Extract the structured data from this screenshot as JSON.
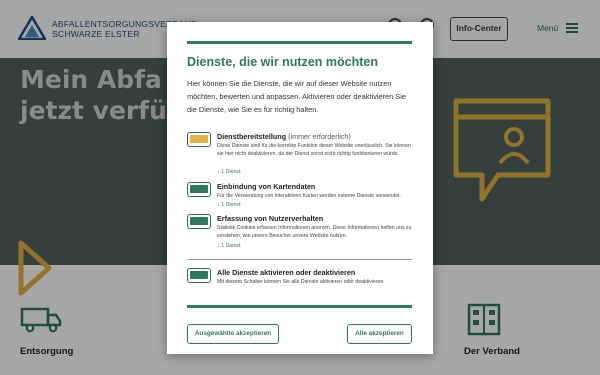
{
  "header": {
    "brand_line1": "ABFALLENTSORGUNGSVERBAND",
    "brand_line2": "SCHWARZE ELSTER",
    "info_button": "Info-Center",
    "menu_label": "Menü"
  },
  "hero": {
    "title_line1": "Mein Abfa",
    "title_line2": "jetzt verfüg"
  },
  "tiles": [
    {
      "label": "Entsorgung"
    },
    {
      "label": "Der Verband"
    }
  ],
  "modal": {
    "title": "Dienste, die wir nutzen möchten",
    "intro": "Hier können Sie die Dienste, die wir auf dieser Website nutzen möchten, bewerten und anpassen. Aktivieren oder deaktivieren Sie die Dienste, wie Sie es für richtig halten.",
    "services": [
      {
        "name": "Dienstbereitstellung",
        "note": "(immer erforderlich)",
        "description": "Diese Dienste sind für die korrekte Funktion dieser Website unerlässlich. Sie können sie hier nicht deaktivieren, da der Dienst sonst nicht richtig funktionieren würde.",
        "count": "↓ 1 Dienst"
      },
      {
        "name": "Einbindung von Kartendaten",
        "description": "Für die Verwendung von interaktiven Karten werden externe Dienste verwendet.",
        "count": "↓ 1 Dienst"
      },
      {
        "name": "Erfassung von Nutzerverhalten",
        "description": "Statistik Cookies erfassen Informationen anonym. Diese Informationen helfen uns zu verstehen, wie unsere Besucher unsere Website nutzen.",
        "count": "↓ 1 Dienst"
      }
    ],
    "all_toggle": {
      "name": "Alle Dienste aktivieren oder deaktivieren",
      "description": "Mit diesem Schalter können Sie alle Dienste aktivieren oder deaktivieren."
    },
    "accept_selected": "Ausgewählte akzeptieren",
    "accept_all": "Alle akzeptieren"
  },
  "colors": {
    "accent_green": "#2e7a5d",
    "hero_bg": "#506260",
    "required_toggle": "#e4b347",
    "info_icon_gold": "#e0b13c"
  }
}
